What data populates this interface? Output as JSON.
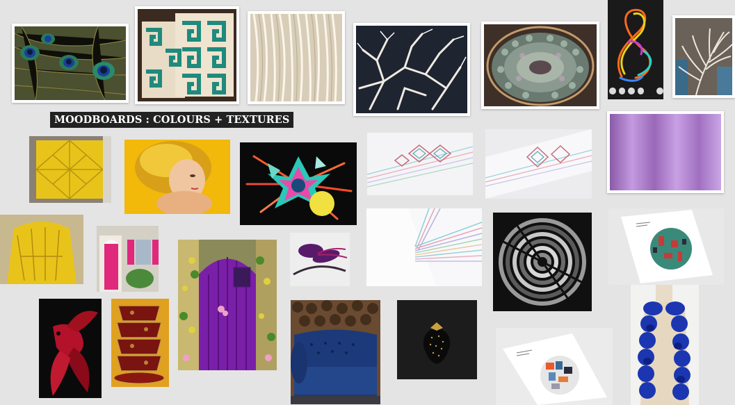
{
  "board": {
    "title": "MOODBOARDS : COLOURS + TEXTURES",
    "background": "#e4e4e4"
  },
  "tiles": [
    {
      "id": "peacock-feathers",
      "subject": "peacock feathers"
    },
    {
      "id": "greek-key-pillows",
      "subject": "teal greek key cushions"
    },
    {
      "id": "paper-strips",
      "subject": "cream paper strip texture"
    },
    {
      "id": "white-coral-sculpture",
      "subject": "white branching coral sculpture"
    },
    {
      "id": "iridescent-scales-dome",
      "subject": "iridescent scale mosaic dome"
    },
    {
      "id": "light-painting",
      "subject": "colourful light painting swirl"
    },
    {
      "id": "ostrich-feather",
      "subject": "white ostrich feather"
    },
    {
      "id": "yellow-origami-cushion",
      "subject": "yellow origami cushion"
    },
    {
      "id": "yellow-hair-portrait",
      "subject": "portrait with yellow hair"
    },
    {
      "id": "paper-burst-art",
      "subject": "colourful paper burst artwork"
    },
    {
      "id": "aztec-pattern-1",
      "subject": "aztec pattern paper installation"
    },
    {
      "id": "aztec-pattern-2",
      "subject": "aztec pattern paper installation"
    },
    {
      "id": "lilac-curtain",
      "subject": "lilac velvet curtain"
    },
    {
      "id": "yellow-paper-chair",
      "subject": "yellow paper chair"
    },
    {
      "id": "pink-door",
      "subject": "pink door and shutters"
    },
    {
      "id": "purple-door",
      "subject": "purple door with flowers"
    },
    {
      "id": "feather-fascinator",
      "subject": "purple feather fascinator"
    },
    {
      "id": "pastel-paper-lines",
      "subject": "pastel paper lines"
    },
    {
      "id": "monochrome-circle",
      "subject": "monochrome circle artwork"
    },
    {
      "id": "map-print-poster",
      "subject": "circular map print poster"
    },
    {
      "id": "red-betta-fish",
      "subject": "red betta fish"
    },
    {
      "id": "red-teacups",
      "subject": "stacked red teacups"
    },
    {
      "id": "blue-chesterfield",
      "subject": "blue velvet chesterfield sofa"
    },
    {
      "id": "black-strawberry",
      "subject": "black gold strawberry"
    },
    {
      "id": "circle-print-poster",
      "subject": "circle print poster"
    },
    {
      "id": "blue-ruffle-scarf",
      "subject": "blue ruffle scarf"
    }
  ],
  "toolbar_icons": [
    "edit-icon",
    "grid-icon",
    "layers-icon",
    "share-icon",
    "menu-icon"
  ],
  "colors": {
    "teal": "#1f8a7d",
    "yellow": "#e8c41a",
    "purple": "#7a1fa8",
    "pink": "#e0287d",
    "lilac": "#b98ad6",
    "crimson": "#b3122a",
    "navy": "#1c3a7a",
    "royal_blue": "#1b36b0"
  }
}
